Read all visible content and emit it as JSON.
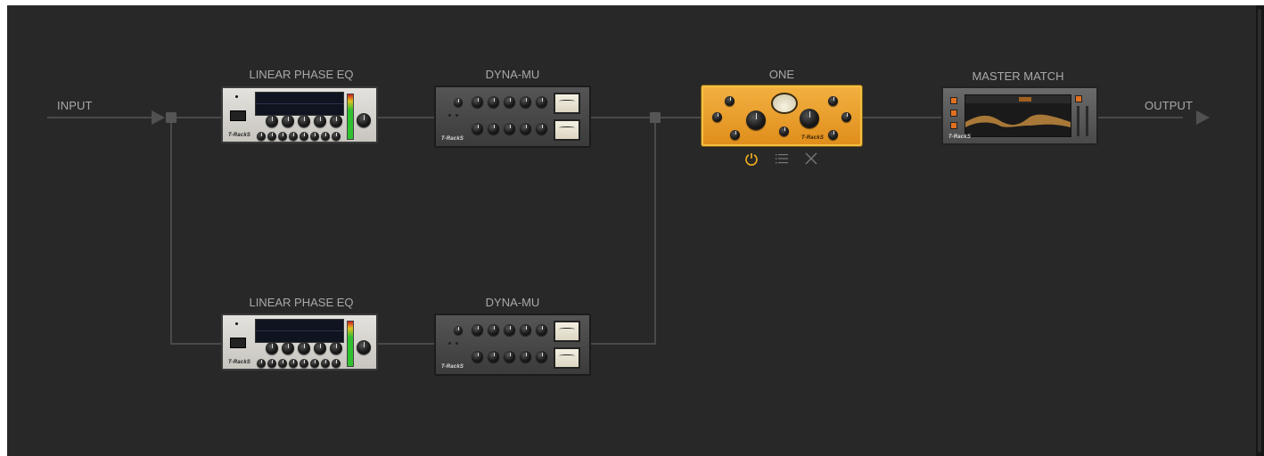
{
  "chain": {
    "input_label": "INPUT",
    "output_label": "OUTPUT"
  },
  "top_row": [
    {
      "name": "LINEAR PHASE EQ"
    },
    {
      "name": "DYNA-MU"
    },
    {
      "name": "ONE"
    },
    {
      "name": "MASTER MATCH"
    }
  ],
  "bottom_row": [
    {
      "name": "LINEAR PHASE EQ"
    },
    {
      "name": "DYNA-MU"
    }
  ],
  "selected_controls": {
    "power_icon": "power-icon",
    "menu_icon": "list-menu-icon",
    "remove_icon": "close-icon"
  },
  "colors": {
    "background": "#282828",
    "wire": "#4a4a4a",
    "label": "#a9a9a9",
    "accent": "#f5b020"
  }
}
